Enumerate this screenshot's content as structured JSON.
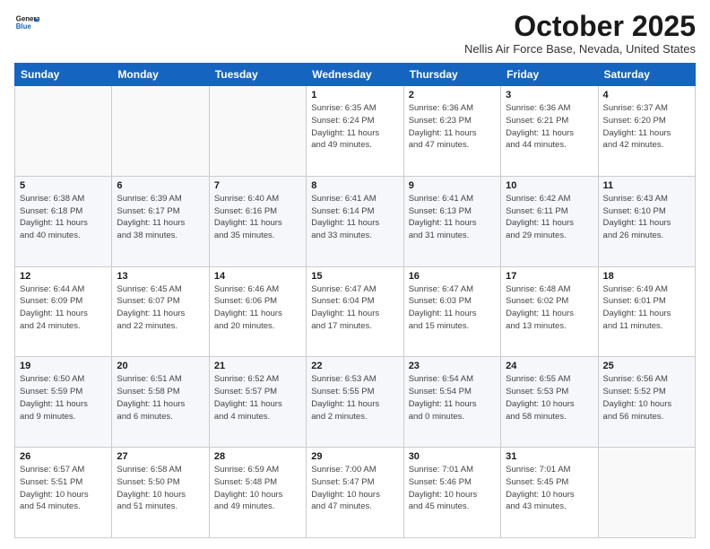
{
  "logo": {
    "line1": "General",
    "line2": "Blue"
  },
  "title": "October 2025",
  "subtitle": "Nellis Air Force Base, Nevada, United States",
  "days_of_week": [
    "Sunday",
    "Monday",
    "Tuesday",
    "Wednesday",
    "Thursday",
    "Friday",
    "Saturday"
  ],
  "weeks": [
    [
      {
        "day": "",
        "info": ""
      },
      {
        "day": "",
        "info": ""
      },
      {
        "day": "",
        "info": ""
      },
      {
        "day": "1",
        "info": "Sunrise: 6:35 AM\nSunset: 6:24 PM\nDaylight: 11 hours\nand 49 minutes."
      },
      {
        "day": "2",
        "info": "Sunrise: 6:36 AM\nSunset: 6:23 PM\nDaylight: 11 hours\nand 47 minutes."
      },
      {
        "day": "3",
        "info": "Sunrise: 6:36 AM\nSunset: 6:21 PM\nDaylight: 11 hours\nand 44 minutes."
      },
      {
        "day": "4",
        "info": "Sunrise: 6:37 AM\nSunset: 6:20 PM\nDaylight: 11 hours\nand 42 minutes."
      }
    ],
    [
      {
        "day": "5",
        "info": "Sunrise: 6:38 AM\nSunset: 6:18 PM\nDaylight: 11 hours\nand 40 minutes."
      },
      {
        "day": "6",
        "info": "Sunrise: 6:39 AM\nSunset: 6:17 PM\nDaylight: 11 hours\nand 38 minutes."
      },
      {
        "day": "7",
        "info": "Sunrise: 6:40 AM\nSunset: 6:16 PM\nDaylight: 11 hours\nand 35 minutes."
      },
      {
        "day": "8",
        "info": "Sunrise: 6:41 AM\nSunset: 6:14 PM\nDaylight: 11 hours\nand 33 minutes."
      },
      {
        "day": "9",
        "info": "Sunrise: 6:41 AM\nSunset: 6:13 PM\nDaylight: 11 hours\nand 31 minutes."
      },
      {
        "day": "10",
        "info": "Sunrise: 6:42 AM\nSunset: 6:11 PM\nDaylight: 11 hours\nand 29 minutes."
      },
      {
        "day": "11",
        "info": "Sunrise: 6:43 AM\nSunset: 6:10 PM\nDaylight: 11 hours\nand 26 minutes."
      }
    ],
    [
      {
        "day": "12",
        "info": "Sunrise: 6:44 AM\nSunset: 6:09 PM\nDaylight: 11 hours\nand 24 minutes."
      },
      {
        "day": "13",
        "info": "Sunrise: 6:45 AM\nSunset: 6:07 PM\nDaylight: 11 hours\nand 22 minutes."
      },
      {
        "day": "14",
        "info": "Sunrise: 6:46 AM\nSunset: 6:06 PM\nDaylight: 11 hours\nand 20 minutes."
      },
      {
        "day": "15",
        "info": "Sunrise: 6:47 AM\nSunset: 6:04 PM\nDaylight: 11 hours\nand 17 minutes."
      },
      {
        "day": "16",
        "info": "Sunrise: 6:47 AM\nSunset: 6:03 PM\nDaylight: 11 hours\nand 15 minutes."
      },
      {
        "day": "17",
        "info": "Sunrise: 6:48 AM\nSunset: 6:02 PM\nDaylight: 11 hours\nand 13 minutes."
      },
      {
        "day": "18",
        "info": "Sunrise: 6:49 AM\nSunset: 6:01 PM\nDaylight: 11 hours\nand 11 minutes."
      }
    ],
    [
      {
        "day": "19",
        "info": "Sunrise: 6:50 AM\nSunset: 5:59 PM\nDaylight: 11 hours\nand 9 minutes."
      },
      {
        "day": "20",
        "info": "Sunrise: 6:51 AM\nSunset: 5:58 PM\nDaylight: 11 hours\nand 6 minutes."
      },
      {
        "day": "21",
        "info": "Sunrise: 6:52 AM\nSunset: 5:57 PM\nDaylight: 11 hours\nand 4 minutes."
      },
      {
        "day": "22",
        "info": "Sunrise: 6:53 AM\nSunset: 5:55 PM\nDaylight: 11 hours\nand 2 minutes."
      },
      {
        "day": "23",
        "info": "Sunrise: 6:54 AM\nSunset: 5:54 PM\nDaylight: 11 hours\nand 0 minutes."
      },
      {
        "day": "24",
        "info": "Sunrise: 6:55 AM\nSunset: 5:53 PM\nDaylight: 10 hours\nand 58 minutes."
      },
      {
        "day": "25",
        "info": "Sunrise: 6:56 AM\nSunset: 5:52 PM\nDaylight: 10 hours\nand 56 minutes."
      }
    ],
    [
      {
        "day": "26",
        "info": "Sunrise: 6:57 AM\nSunset: 5:51 PM\nDaylight: 10 hours\nand 54 minutes."
      },
      {
        "day": "27",
        "info": "Sunrise: 6:58 AM\nSunset: 5:50 PM\nDaylight: 10 hours\nand 51 minutes."
      },
      {
        "day": "28",
        "info": "Sunrise: 6:59 AM\nSunset: 5:48 PM\nDaylight: 10 hours\nand 49 minutes."
      },
      {
        "day": "29",
        "info": "Sunrise: 7:00 AM\nSunset: 5:47 PM\nDaylight: 10 hours\nand 47 minutes."
      },
      {
        "day": "30",
        "info": "Sunrise: 7:01 AM\nSunset: 5:46 PM\nDaylight: 10 hours\nand 45 minutes."
      },
      {
        "day": "31",
        "info": "Sunrise: 7:01 AM\nSunset: 5:45 PM\nDaylight: 10 hours\nand 43 minutes."
      },
      {
        "day": "",
        "info": ""
      }
    ]
  ]
}
